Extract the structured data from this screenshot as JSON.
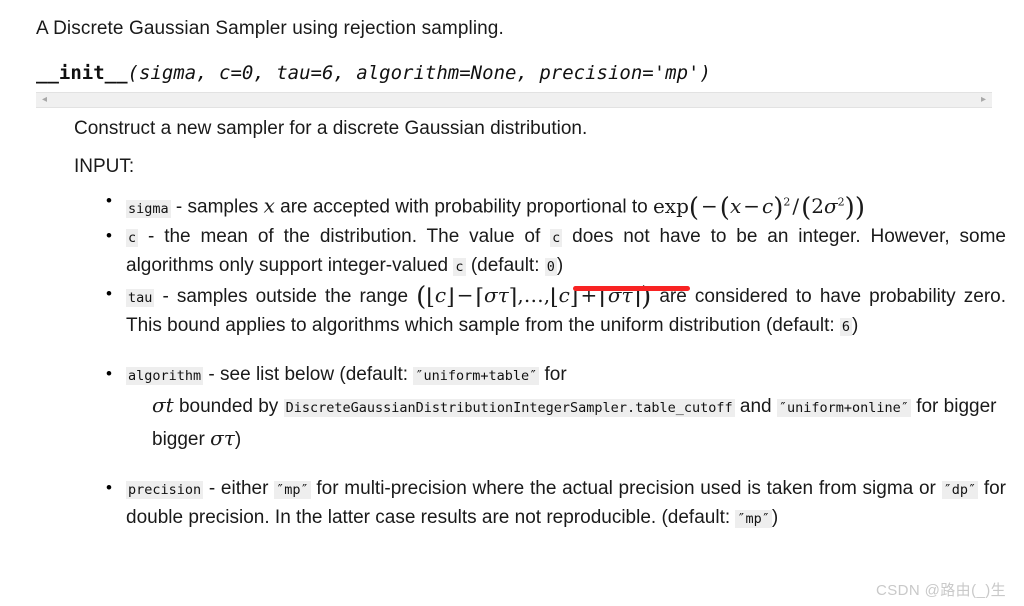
{
  "document": {
    "intro": "A Discrete Gaussian Sampler using rejection sampling.",
    "signature": {
      "name": "__init__",
      "args": "(sigma, c=0, tau=6, algorithm=None, precision='mp')",
      "full": "__init__(sigma, c=0, tau=6, algorithm=None, precision='mp')"
    },
    "scrollbar": {
      "left_arrow": "◂",
      "right_arrow": "▸"
    },
    "construct_line": "Construct a new sampler for a discrete Gaussian distribution.",
    "input_heading": "INPUT:",
    "bullets": [
      {
        "param": "sigma",
        "text_before": " - samples ",
        "math_x": "x",
        "text_mid": " are accepted with probability proportional to ",
        "math_expr": "exp(−(x − c)²/(2σ²))"
      },
      {
        "param": "c",
        "seg1": " - the mean of the distribution. The value of ",
        "param2": "c",
        "seg2": " does not have to be an integer. However, some algorithms only support integer-valued ",
        "param3": "c",
        "seg3": " (default: ",
        "default_value": "0",
        "seg4": ")"
      },
      {
        "param": "tau",
        "seg1": " - samples outside the range ",
        "math_expr": "(⌊c⌋ − ⌈στ⌉, … , ⌊c⌋ + ⌈στ⌉)",
        "seg2": " are considered to have probability zero. This bound applies to algorithms which sample from the uniform distribution (default: ",
        "default_value": "6",
        "seg3": ")"
      },
      {
        "param": "algorithm",
        "seg1": " - see list below (default: ",
        "default_value": "″uniform+table″",
        "seg2": " for ",
        "math_sigma_t": "σt",
        "seg3": " bounded by ",
        "code_ref": "DiscreteGaussianDistributionIntegerSampler.table_cutoff",
        "seg4": " and ",
        "alt_value": "″uniform+online″",
        "seg5": " for bigger ",
        "math_sigma_tau": "στ",
        "seg6": ")"
      },
      {
        "param": "precision",
        "seg1": " - either ",
        "value_mp": "″mp″",
        "seg2": " for multi-precision where the actual precision used is taken from sigma or ",
        "value_dp": "″dp″",
        "seg3": " for double precision. In the latter case results are not reproducible. (default: ",
        "default_value": "″mp″",
        "seg4": ")"
      }
    ],
    "annotation": {
      "type": "red-underline",
      "color": "#f82323",
      "target": "(default: 0)"
    },
    "watermark": "CSDN @路由(_)生"
  }
}
